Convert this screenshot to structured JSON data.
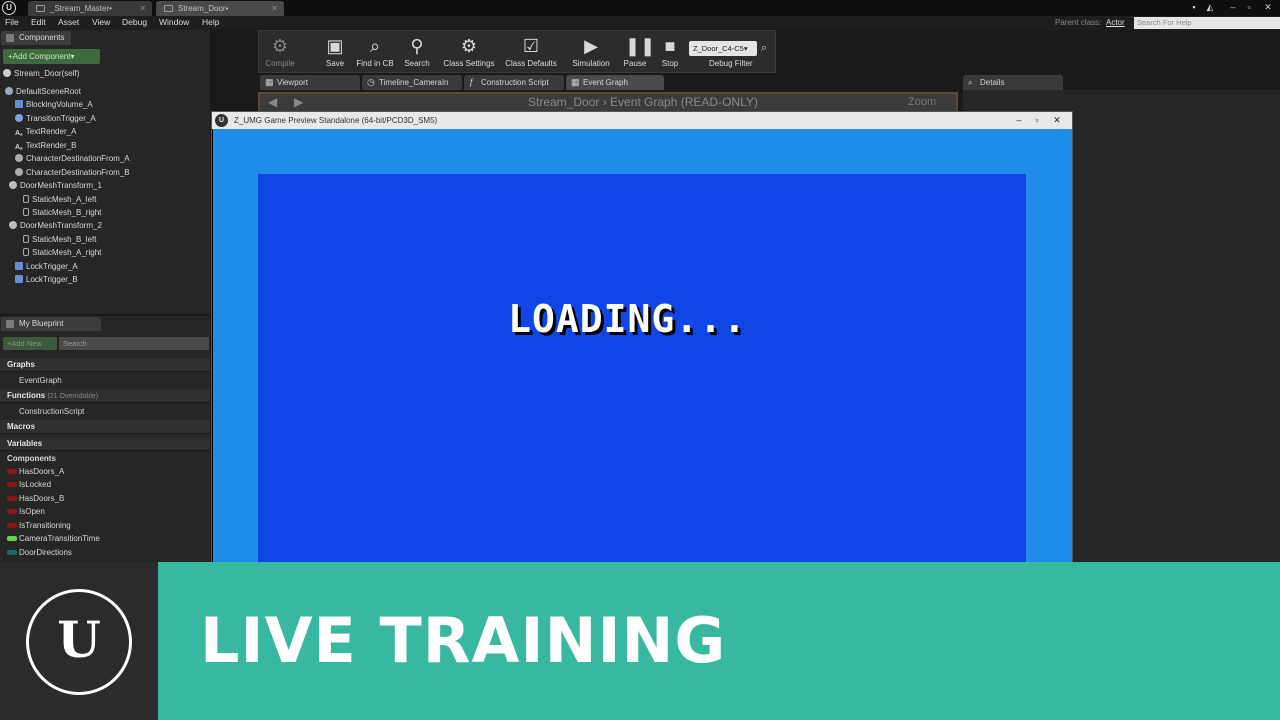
{
  "titlebar": {
    "tabs": [
      {
        "label": "_Stream_Master•"
      },
      {
        "label": "Stream_Door•"
      }
    ]
  },
  "menubar": {
    "items": [
      "File",
      "Edit",
      "Asset",
      "View",
      "Debug",
      "Window",
      "Help"
    ],
    "parent_class_label": "Parent class:",
    "parent_class_value": "Actor",
    "help_search_placeholder": "Search For Help"
  },
  "components_panel": {
    "tab_label": "Components",
    "add_button": "+Add Component▾",
    "self_item": "Stream_Door(self)",
    "tree": [
      {
        "label": "DefaultSceneRoot",
        "icon": "scene-root-icon"
      },
      {
        "label": "BlockingVolume_A",
        "icon": "volume-icon"
      },
      {
        "label": "TransitionTrigger_A",
        "icon": "trigger-icon"
      },
      {
        "label": "TextRender_A",
        "icon": "text-render-icon"
      },
      {
        "label": "TextRender_B",
        "icon": "text-render-icon"
      },
      {
        "label": "CharacterDestinationFrom_A",
        "icon": "character-icon"
      },
      {
        "label": "CharacterDestinationFrom_B",
        "icon": "character-icon"
      },
      {
        "label": "DoorMeshTransform_1",
        "icon": "mesh-transform-icon"
      },
      {
        "label": "StaticMesh_A_left",
        "icon": "static-mesh-icon"
      },
      {
        "label": "StaticMesh_B_right",
        "icon": "static-mesh-icon"
      },
      {
        "label": "DoorMeshTransform_2",
        "icon": "mesh-transform-icon"
      },
      {
        "label": "StaticMesh_B_left",
        "icon": "static-mesh-icon"
      },
      {
        "label": "StaticMesh_A_right",
        "icon": "static-mesh-icon"
      },
      {
        "label": "LockTrigger_A",
        "icon": "trigger-icon"
      },
      {
        "label": "LockTrigger_B",
        "icon": "trigger-icon"
      }
    ]
  },
  "my_blueprint": {
    "tab_label": "My Blueprint",
    "add_new": "+Add New",
    "search_placeholder": "Search",
    "sections": {
      "graphs": "Graphs",
      "event_graph": "EventGraph",
      "functions": "Functions",
      "functions_note": "(21 Overridable)",
      "construction_script": "ConstructionScript",
      "macros": "Macros",
      "variables": "Variables",
      "components": "Components"
    },
    "variables": [
      {
        "name": "HasDoors_A",
        "color": "#8a1616"
      },
      {
        "name": "IsLocked",
        "color": "#8a1616"
      },
      {
        "name": "HasDoors_B",
        "color": "#8a1616"
      },
      {
        "name": "IsOpen",
        "color": "#8a1616"
      },
      {
        "name": "IsTransitioning",
        "color": "#8a1616"
      },
      {
        "name": "CameraTransitionTime",
        "color": "#6bd04a"
      },
      {
        "name": "DoorDirections",
        "color": "#1a6a6a"
      }
    ]
  },
  "toolbar": {
    "compile": "Compile",
    "save": "Save",
    "find_in_cb": "Find in CB",
    "search": "Search",
    "class_settings": "Class Settings",
    "class_defaults": "Class Defaults",
    "simulation": "Simulation",
    "pause": "Pause",
    "stop": "Stop",
    "debug_filter_value": "Z_Door_C4-C5▾",
    "debug_filter_label": "Debug Filter"
  },
  "editor_tabs": [
    {
      "label": "Viewport"
    },
    {
      "label": "Timeline_CameraIn"
    },
    {
      "label": "Construction Script"
    },
    {
      "label": "Event Graph"
    }
  ],
  "graph": {
    "breadcrumb": "Stream_Door  ›  Event Graph  (READ-ONLY)",
    "zoom": "Zoom"
  },
  "preview_window": {
    "title": "Z_UMG Game Preview Standalone (64-bit/PCD3D_SM5)",
    "loading_text": "LOADING...",
    "colors": {
      "outer": "#1e8ce8",
      "inner": "#1045e6"
    }
  },
  "details": {
    "tab_label": "Details"
  },
  "banner": {
    "title": "LIVE TRAINING",
    "accent": "#38b99f"
  }
}
